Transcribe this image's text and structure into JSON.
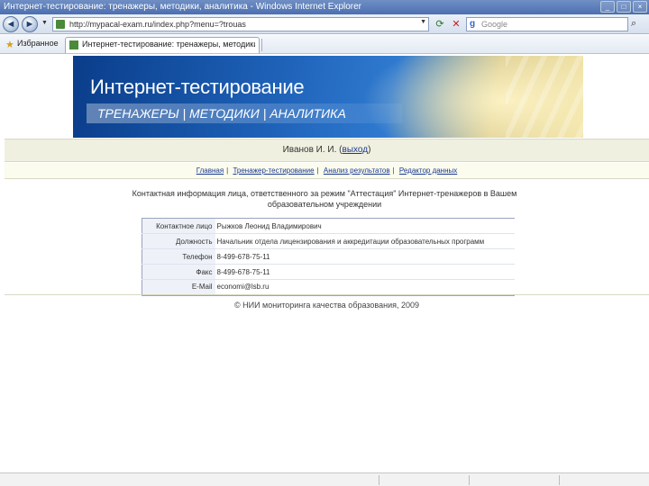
{
  "window": {
    "title": "Интернет-тестирование: тренажеры, методики, аналитика - Windows Internet Explorer",
    "controls": [
      "_",
      "□",
      "×"
    ]
  },
  "navbar": {
    "back_glyph": "◄",
    "forward_glyph": "►",
    "dropdown_glyph": "▼",
    "address": "http://mypacal-exam.ru/index.php?menu=?trouas",
    "search_placeholder": "Google",
    "icons": [
      "refresh-icon",
      "stop-icon",
      "search-icon"
    ]
  },
  "favorites": {
    "label": "Избранное",
    "tab_label": "Интернет-тестирование: тренажеры, методики, а..."
  },
  "banner": {
    "title": "Интернет-тестирование",
    "menu": "ТРЕНАЖЕРЫ | МЕТОДИКИ | АНАЛИТИКА"
  },
  "user": {
    "name": "Иванов И. И.",
    "logout_label": "выход",
    "open_paren": " (",
    "close_paren": ")"
  },
  "links": [
    {
      "label": "Главная"
    },
    {
      "label": "Тренажер-тестирование"
    },
    {
      "label": "Анализ результатов"
    },
    {
      "label": "Редактор данных"
    }
  ],
  "content": {
    "heading": "Контактная информация лица, ответственного за режим \"Аттестация\" Интернет-тренажеров в Вашем образовательном учреждении",
    "rows": [
      {
        "key": "Контактное лицо",
        "value": "Рыжков Леонид Владимирович"
      },
      {
        "key": "Должность",
        "value": "Начальник отдела лицензирования и аккредитации образовательных программ"
      },
      {
        "key": "Телефон",
        "value": "8-499-678-75-11"
      },
      {
        "key": "Факс",
        "value": "8-499-678-75-11"
      },
      {
        "key": "E-Mail",
        "value": "economi@lsb.ru"
      }
    ]
  },
  "footer": {
    "text": "© НИИ мониторинга качества образования, 2009"
  }
}
